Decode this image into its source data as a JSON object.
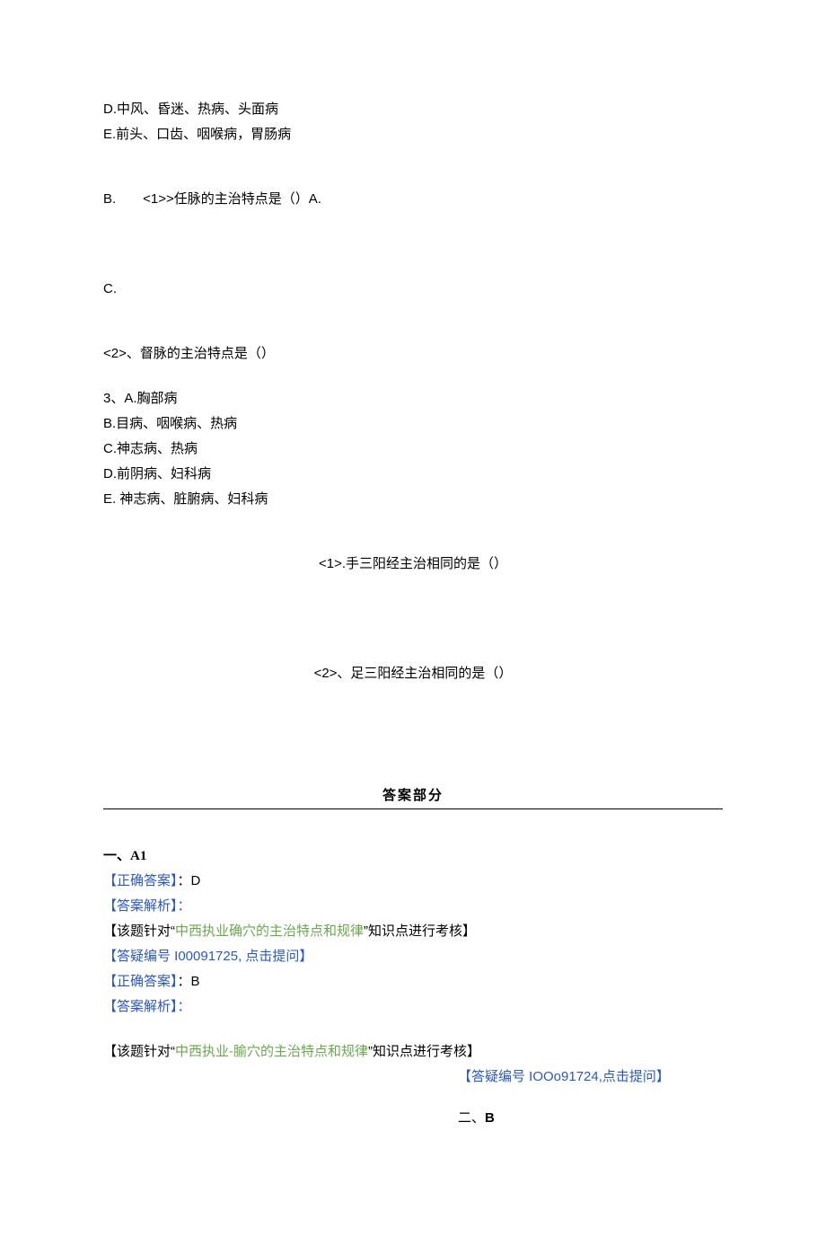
{
  "top_options": {
    "D": "D.中风、昏迷、热病、头面病",
    "E": "E.前头、口齿、咽喉病，胃肠病"
  },
  "line_B": "B.　　<1>>任脉的主治特点是（）A.",
  "line_C": "C.",
  "q_du": "<2>、督脉的主治特点是（）",
  "q3": {
    "lead": "3、A.胸部病",
    "B": "B.目病、咽喉病、热病",
    "C": "C.神志病、热病",
    "D": "D.前阴病、妇科病",
    "E": "E. 神志病、脏腑病、妇科病"
  },
  "sub1": "<1>.手三阳经主治相同的是（）",
  "sub2": "<2>、足三阳经主治相同的是（）",
  "answer_section_title": "答案部分",
  "answers": {
    "section1_label": "一、A1",
    "correct_label": "【正确答案】",
    "correct_sep": "：",
    "ans_D": "D",
    "analysis_label": "【答案解析】：",
    "target_prefix": "【该题针对“",
    "target1_green": "中西执业确穴的主治特点和规律",
    "target2_green": "中西执业-腧穴的主治特点和规律",
    "target_suffix": "”知识点进行考核】",
    "inquiry1_full": "【答疑编号 I00091725, 点击提问】",
    "ans_B": "B",
    "inquiry2_prefix": "【答疑编号 ",
    "inquiry2_id": "IOOo91724,",
    "inquiry2_suffix": "点击提问】",
    "section2_label": "二、B"
  }
}
